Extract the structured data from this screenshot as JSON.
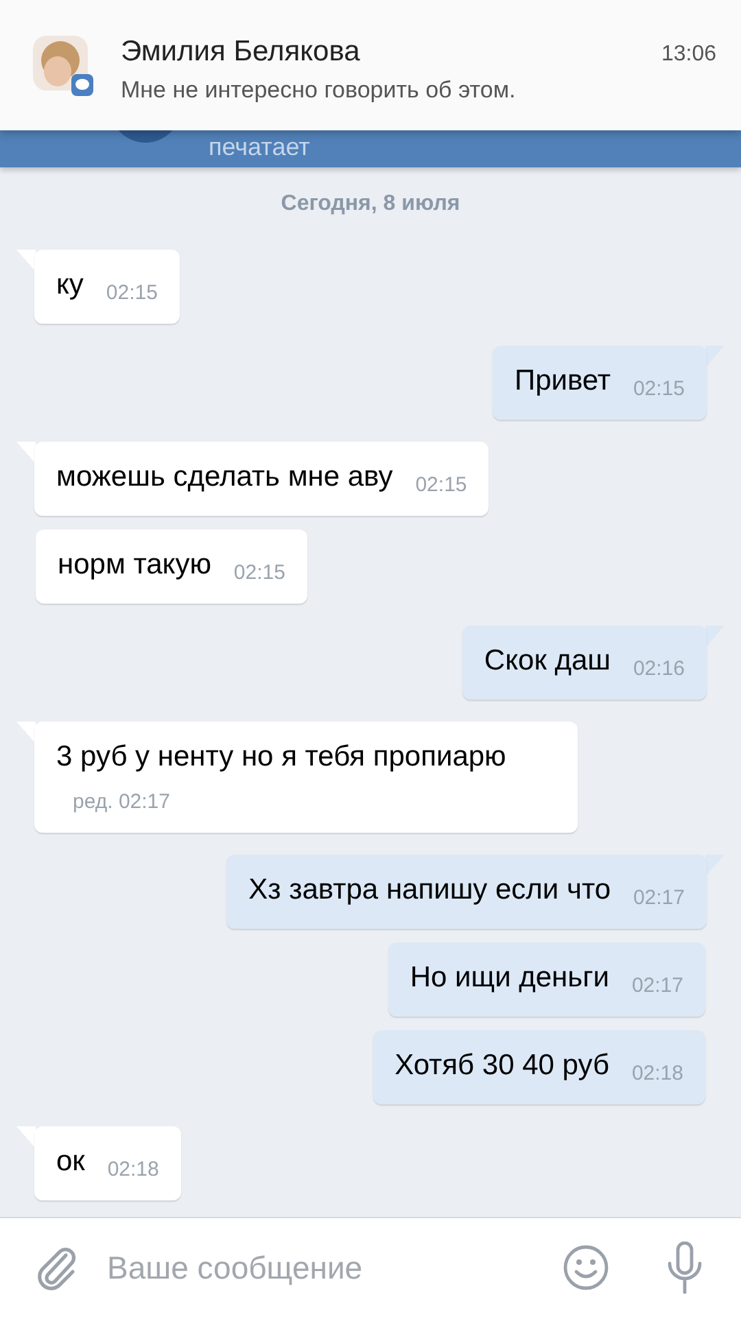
{
  "notification": {
    "sender": "Эмилия Белякова",
    "text": "Мне не интересно говорить об этом.",
    "time": "13:06"
  },
  "header": {
    "status": "печатает"
  },
  "date": "Сегодня, 8 июля",
  "messages": [
    {
      "kind": "in",
      "tail": true,
      "text": "ку",
      "time": "02:15"
    },
    {
      "kind": "out",
      "tail": true,
      "text": "Привет",
      "time": "02:15"
    },
    {
      "kind": "in",
      "tail": true,
      "text": "можешь сделать мне аву",
      "time": "02:15"
    },
    {
      "kind": "in",
      "tail": false,
      "text": "норм такую",
      "time": "02:15"
    },
    {
      "kind": "out",
      "tail": true,
      "text": "Скок даш",
      "time": "02:16"
    },
    {
      "kind": "in",
      "tail": true,
      "text": "3 руб у ненту но я тебя пропиарю",
      "time": "ред. 02:17"
    },
    {
      "kind": "out",
      "tail": true,
      "text": "Хз завтра напишу если что",
      "time": "02:17"
    },
    {
      "kind": "out",
      "tail": false,
      "text": "Но ищи деньги",
      "time": "02:17"
    },
    {
      "kind": "out",
      "tail": false,
      "text": "Хотяб 30 40 руб",
      "time": "02:18"
    },
    {
      "kind": "in",
      "tail": true,
      "text": "ок",
      "time": "02:18"
    }
  ],
  "composer": {
    "placeholder": "Ваше сообщение"
  }
}
